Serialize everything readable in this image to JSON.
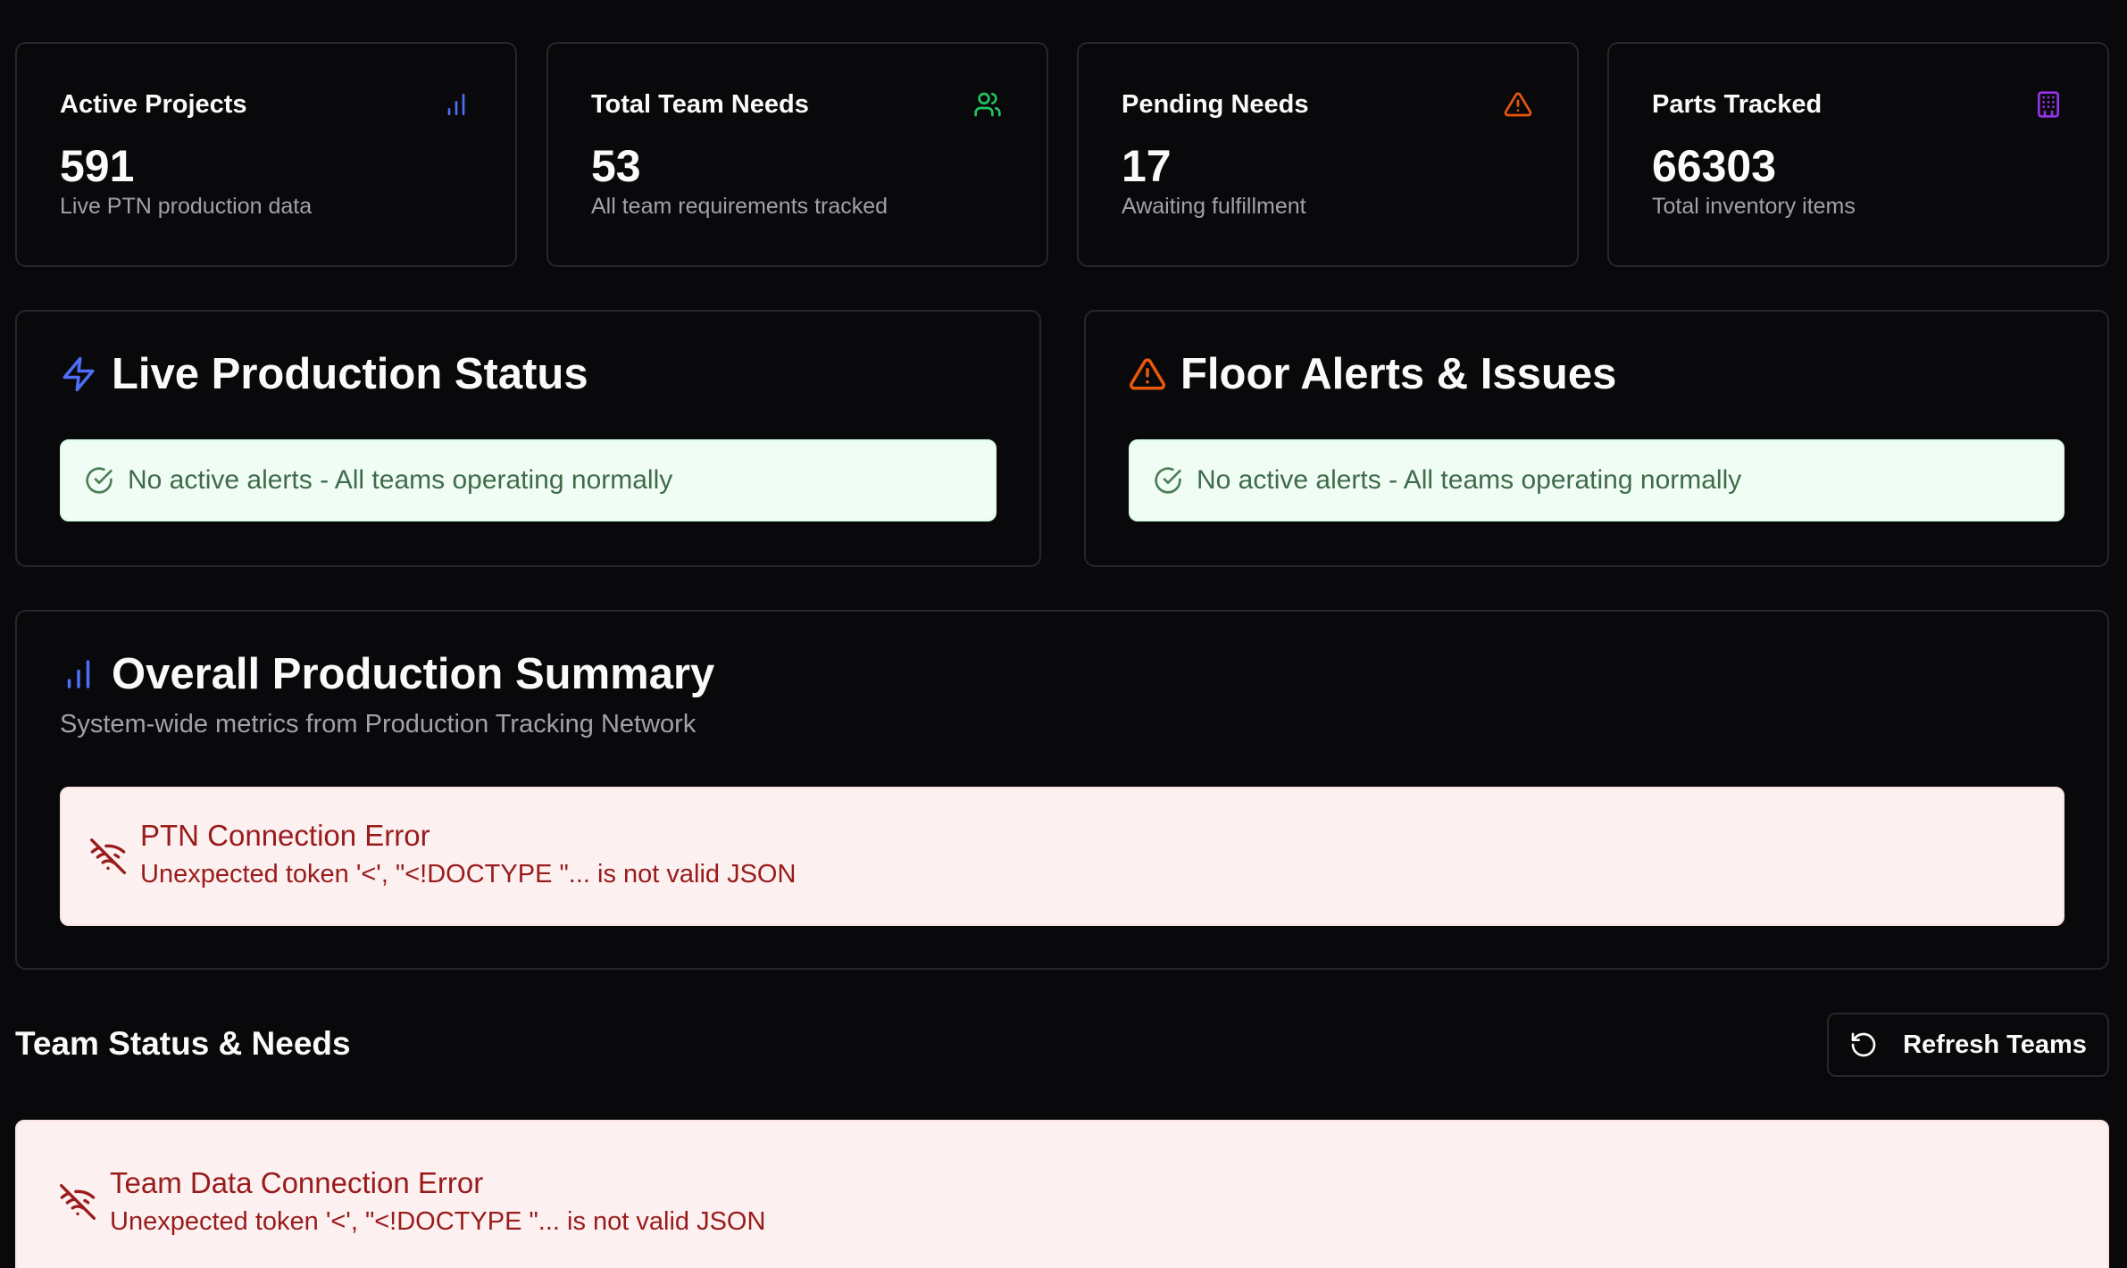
{
  "stats": [
    {
      "label": "Active Projects",
      "value": "591",
      "sub": "Live PTN production data",
      "icon": "bar-chart-icon",
      "color": "#4f6ef7"
    },
    {
      "label": "Total Team Needs",
      "value": "53",
      "sub": "All team requirements tracked",
      "icon": "users-icon",
      "color": "#22c55e"
    },
    {
      "label": "Pending Needs",
      "value": "17",
      "sub": "Awaiting fulfillment",
      "icon": "warning-icon",
      "color": "#ea580c"
    },
    {
      "label": "Parts Tracked",
      "value": "66303",
      "sub": "Total inventory items",
      "icon": "building-icon",
      "color": "#9333ea"
    }
  ],
  "live_status": {
    "title": "Live Production Status",
    "message": "No active alerts - All teams operating normally"
  },
  "floor_alerts": {
    "title": "Floor Alerts & Issues",
    "message": "No active alerts - All teams operating normally"
  },
  "summary": {
    "title": "Overall Production Summary",
    "subtitle": "System-wide metrics from Production Tracking Network",
    "error_title": "PTN Connection Error",
    "error_message": "Unexpected token '<', \"<!DOCTYPE \"... is not valid JSON"
  },
  "teams": {
    "title": "Team Status & Needs",
    "refresh_label": "Refresh Teams",
    "error_title": "Team Data Connection Error",
    "error_message": "Unexpected token '<', \"<!DOCTYPE \"... is not valid JSON"
  }
}
